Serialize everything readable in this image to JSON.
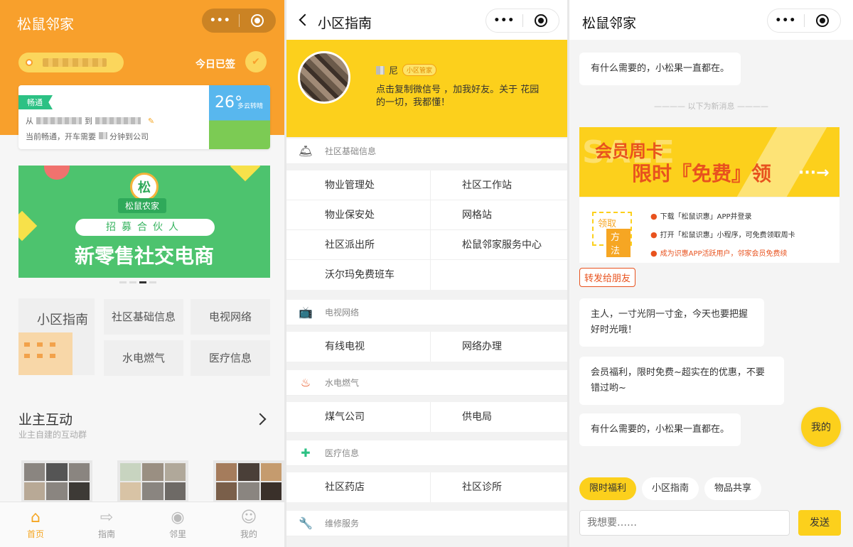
{
  "panel1": {
    "title": "松鼠邻家",
    "capsule": {
      "more": "•••"
    },
    "signin": "今日已签",
    "traffic": {
      "tag": "畅通",
      "from_label": "从",
      "to_label": "到",
      "tip_prefix": "当前畅通，开车需要",
      "tip_suffix": "分钟到公司",
      "temperature": "26°",
      "weather_desc": "多云转晴"
    },
    "banner": {
      "logo_char": "松",
      "brand": "松鼠农家",
      "pill": "招募合伙人",
      "headline": "新零售社交电商"
    },
    "grid": {
      "guide": "小区指南",
      "community_info": "社区基础信息",
      "tv_network": "电视网络",
      "utilities": "水电燃气",
      "medical": "医疗信息"
    },
    "section": {
      "title": "业主互动",
      "subtitle": "业主自建的互动群"
    },
    "tabs": [
      {
        "label": "首页",
        "icon": "home-icon"
      },
      {
        "label": "指南",
        "icon": "signpost-icon"
      },
      {
        "label": "邻里",
        "icon": "broadcast-icon"
      },
      {
        "label": "我的",
        "icon": "user-icon"
      }
    ]
  },
  "panel2": {
    "title": "小区指南",
    "hero": {
      "name_suffix": "尼",
      "role": "小区管家",
      "text": "点击复制微信号 ，加我好友。关于 花园的一切，我都懂！"
    },
    "sections": [
      {
        "name": "社区基础信息",
        "icon": "bell-icon",
        "items": [
          "物业管理处",
          "社区工作站",
          "物业保安处",
          "网格站",
          "社区派出所",
          "松鼠邻家服务中心",
          "沃尔玛免费班车",
          ""
        ]
      },
      {
        "name": "电视网络",
        "icon": "tv-icon",
        "items": [
          "有线电视",
          "网络办理"
        ]
      },
      {
        "name": "水电燃气",
        "icon": "flame-icon",
        "items": [
          "煤气公司",
          "供电局"
        ]
      },
      {
        "name": "医疗信息",
        "icon": "medical-cross-icon",
        "items": [
          "社区药店",
          "社区诊所"
        ]
      },
      {
        "name": "维修服务",
        "icon": "wrench-icon",
        "items": []
      }
    ]
  },
  "panel3": {
    "title": "松鼠邻家",
    "msg_top": "有什么需要的，小松果一直都在。",
    "divider": "———— 以下为新消息 ————",
    "promo": {
      "bg_text": "SALE",
      "line1": "会员周卡",
      "line2": "限时『免费』领",
      "arrow": "···→",
      "method1": "领取",
      "method2": "方法",
      "step1": "下载「松鼠识惠」APP并登录",
      "step2": "打开「松鼠识惠」小程序，可免费领取周卡",
      "step3": "成为识惠APP活跃用户，邻家会员免费续"
    },
    "share": "转发给朋友",
    "msg1": "主人，一寸光阴一寸金，今天也要把握好时光哦！",
    "msg2": "会员福利，限时免费~超实在的优惠，不要错过哟~",
    "msg3": "有什么需要的，小松果一直都在。",
    "mine": "我的",
    "chips": [
      "限时福利",
      "小区指南",
      "物品共享"
    ],
    "input_placeholder": "我想要……",
    "send": "发送"
  }
}
